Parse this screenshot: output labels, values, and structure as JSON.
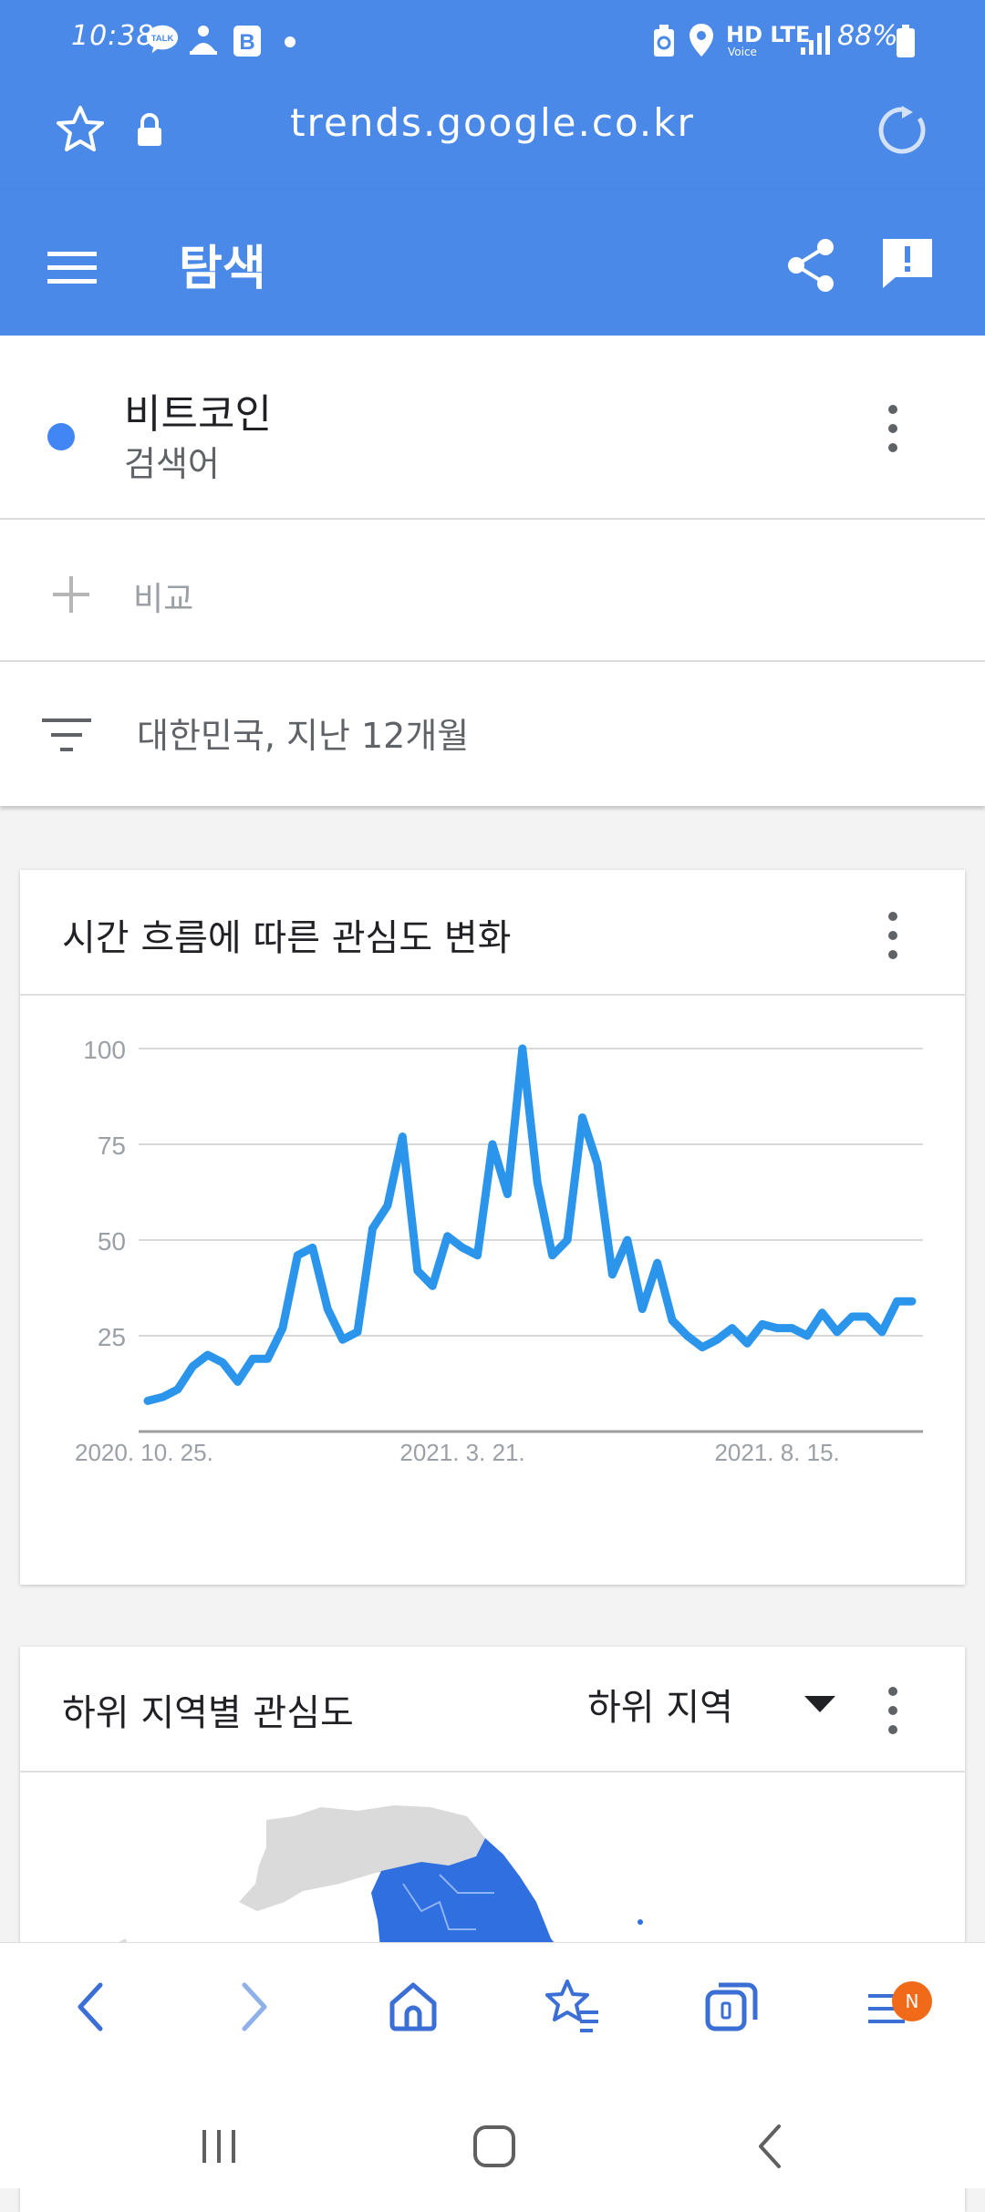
{
  "status_bar": {
    "time": "10:38",
    "battery": "88%",
    "network": "HD LTE",
    "network_sub": "Voice",
    "talk_label": "TALK",
    "b_label": "B"
  },
  "browser": {
    "url": "trends.google.co.kr"
  },
  "appbar": {
    "title": "탐색"
  },
  "search_term": {
    "name": "비트코인",
    "type": "검색어",
    "color": "#4285f4"
  },
  "compare": {
    "label": "비교"
  },
  "filter": {
    "label": "대한민국, 지난 12개월"
  },
  "interest_over_time": {
    "title": "시간 흐름에 따른 관심도 변화"
  },
  "chart_data": {
    "type": "line",
    "title": "시간 흐름에 따른 관심도 변화",
    "xlabel": "",
    "ylabel": "",
    "ylim": [
      0,
      100
    ],
    "yticks": [
      "100",
      "75",
      "50",
      "25"
    ],
    "xticks": [
      "2020. 10. 25.",
      "2021. 3. 21.",
      "2021. 8. 15."
    ],
    "x_start": "2020-10-25",
    "x_step_days": 7,
    "grid": true,
    "series": [
      {
        "color": "#2b95ec",
        "values": [
          8,
          9,
          11,
          17,
          20,
          18,
          13,
          19,
          19,
          27,
          46,
          48,
          32,
          24,
          26,
          53,
          59,
          77,
          42,
          38,
          51,
          48,
          46,
          75,
          62,
          100,
          65,
          46,
          50,
          82,
          70,
          41,
          50,
          32,
          44,
          29,
          25,
          22,
          24,
          27,
          23,
          28,
          27,
          27,
          25,
          31,
          26,
          30,
          30,
          26,
          34,
          34
        ]
      }
    ]
  },
  "subregion": {
    "title": "하위 지역별 관심도",
    "dropdown_value": "하위 지역"
  },
  "browser_nav": {
    "badge": "N"
  }
}
